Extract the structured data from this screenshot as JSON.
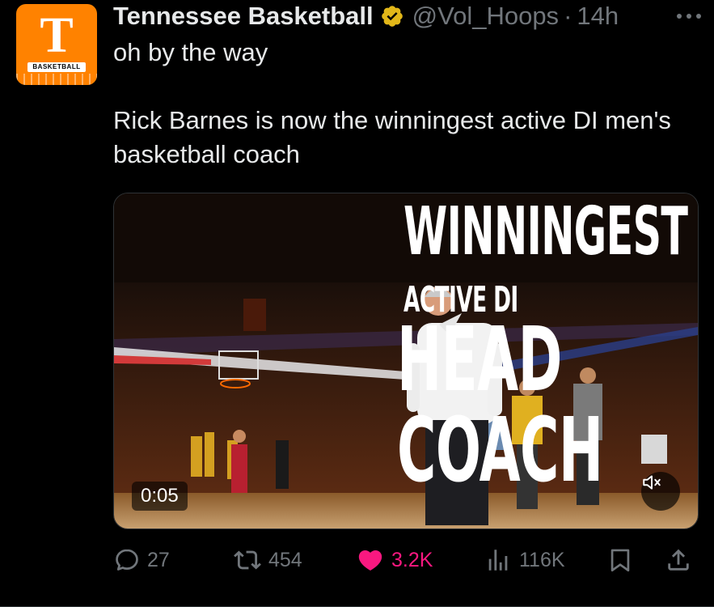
{
  "post": {
    "author_name": "Tennessee Basketball",
    "handle": "@Vol_Hoops",
    "separator": "·",
    "time": "14h",
    "more_icon": "more-horizontal-icon",
    "verified_color": "#e2b719",
    "text_line1": "oh by the way",
    "text_line2": "Rick Barnes is now the winningest active DI men's basketball coach"
  },
  "avatar": {
    "letter": "T",
    "badge": "BASKETBALL",
    "color": "#ff8200"
  },
  "media": {
    "overlay_line1": "WINNINGEST",
    "overlay_line2": "ACTIVE DI",
    "overlay_line3": "HEAD",
    "overlay_line4": "COACH",
    "timer": "0:05",
    "mute_icon": "speaker-muted-icon"
  },
  "actions": {
    "replies": "27",
    "reposts": "454",
    "likes": "3.2K",
    "views": "116K",
    "like_color": "#f91880"
  }
}
